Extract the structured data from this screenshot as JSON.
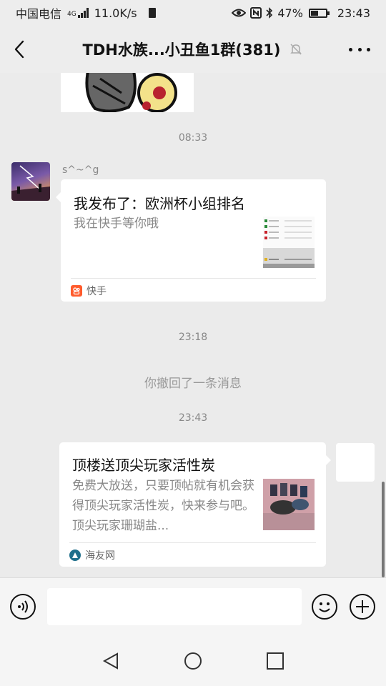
{
  "status_bar": {
    "carrier": "中国电信",
    "network": "4G",
    "speed": "11.0K/s",
    "battery_percent": "47%",
    "battery_level": 0.47,
    "time": "23:43",
    "icons": [
      "signal-icon",
      "sim-icon",
      "eye-icon",
      "nfc-icon",
      "bluetooth-icon",
      "battery-icon"
    ]
  },
  "header": {
    "title": "TDH水族...小丑鱼1群(381)",
    "icons": [
      "back-icon",
      "mute-bell-icon",
      "more-icon"
    ]
  },
  "messages": {
    "time_1": "08:33",
    "sender_1_name": "s^~^g",
    "card_1": {
      "title": "我发布了：欧洲杯小组排名",
      "description": "我在快手等你哦",
      "source": "快手",
      "source_color": "#ff5b2c"
    },
    "time_2": "23:18",
    "recall_notice": "你撤回了一条消息",
    "time_3": "23:43",
    "card_2": {
      "title": "顶楼送顶尖玩家活性炭",
      "description": "免费大放送，只要顶帖就有机会获得顶尖玩家活性炭，快来参与吧。顶尖玩家珊瑚盐...",
      "source": "海友网",
      "source_color": "#1f6f8b"
    }
  },
  "input_bar": {
    "placeholder": "",
    "icons": [
      "voice-icon",
      "emoji-icon",
      "plus-icon"
    ]
  },
  "nav_bar": {
    "icons": [
      "nav-back-icon",
      "nav-home-icon",
      "nav-recents-icon"
    ]
  }
}
